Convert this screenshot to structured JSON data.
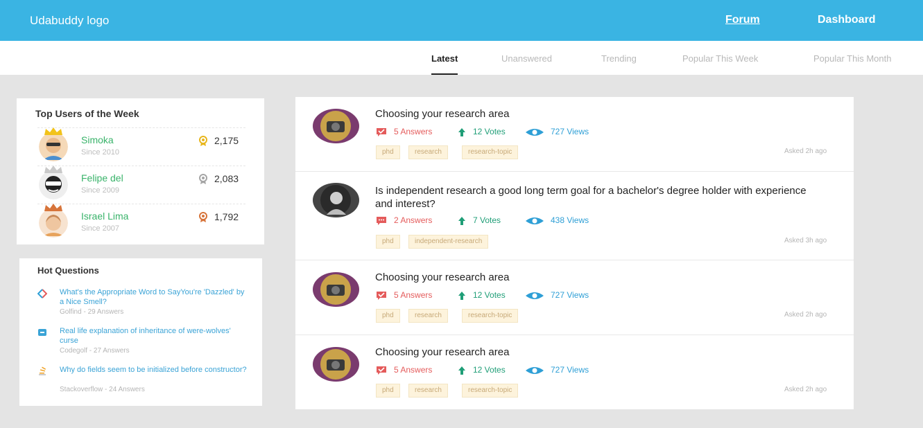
{
  "header": {
    "logo": "Udabuddy logo",
    "nav": {
      "forum": "Forum",
      "dashboard": "Dashboard"
    }
  },
  "tabs": [
    "Latest",
    "Unanswered",
    "Trending",
    "Popular This Week",
    "Popular This Month"
  ],
  "top_users": {
    "title": "Top Users of the Week",
    "users": [
      {
        "name": "Simoka",
        "since": "Since 2010",
        "points": "2,175",
        "medal_color": "#e8b61c"
      },
      {
        "name": "Felipe del",
        "since": "Since 2009",
        "points": "2,083",
        "medal_color": "#a5a5a5"
      },
      {
        "name": "Israel Lima",
        "since": "Since 2007",
        "points": "1,792",
        "medal_color": "#d7743a"
      }
    ]
  },
  "hot_questions": {
    "title": "Hot Questions",
    "items": [
      {
        "text": "What's the Appropriate Word to SayYou're 'Dazzled' by a Nice Smell?",
        "meta": "Golfind - 29 Answers",
        "icon": "english-site-icon"
      },
      {
        "text": "Real life explanation of inheritance of were-wolves' curse",
        "meta": "Codegolf - 27 Answers",
        "icon": "codegolf-site-icon"
      },
      {
        "text": "Why do fields seem to be initialized before constructor?",
        "meta": "Stackoverflow - 24 Answers",
        "icon": "stackoverflow-site-icon"
      }
    ]
  },
  "posts": [
    {
      "title": "Choosing your research area",
      "answers": "5 Answers",
      "votes": "12 Votes",
      "views": "727 Views",
      "tags": [
        "phd",
        "research",
        "research-topic"
      ],
      "asked": "Asked 2h ago"
    },
    {
      "title": "Is independent research a good long term goal for a bachelor's degree holder with experience and interest?",
      "answers": "2 Answers",
      "votes": "7 Votes",
      "views": "438 Views",
      "tags": [
        "phd",
        "independent-research"
      ],
      "asked": "Asked 3h ago"
    },
    {
      "title": "Choosing your research area",
      "answers": "5 Answers",
      "votes": "12 Votes",
      "views": "727 Views",
      "tags": [
        "phd",
        "research",
        "research-topic"
      ],
      "asked": "Asked 2h ago"
    },
    {
      "title": "Choosing your research area",
      "answers": "5 Answers",
      "votes": "12 Votes",
      "views": "727 Views",
      "tags": [
        "phd",
        "research",
        "research-topic"
      ],
      "asked": "Asked 2h ago"
    }
  ],
  "colors": {
    "header": "#3ab4e3",
    "answers": "#e45b5b",
    "votes": "#1f9e77",
    "views": "#2e9fd6",
    "user_name": "#39b36a",
    "link": "#3aa3d6",
    "tag_bg": "#fdf3dc"
  }
}
